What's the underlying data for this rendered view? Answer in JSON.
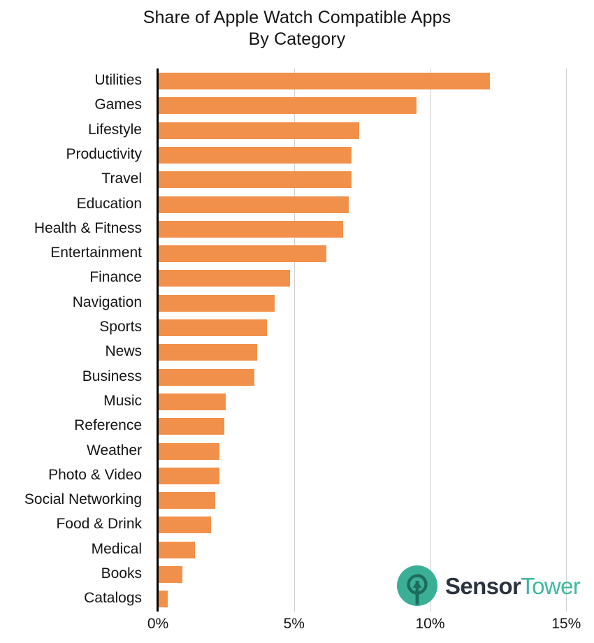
{
  "chart_data": {
    "type": "bar",
    "orientation": "horizontal",
    "title": "Share of Apple Watch Compatible Apps By Category",
    "title_lines": [
      "Share of Apple Watch Compatible Apps",
      "By Category"
    ],
    "xlabel": "",
    "ylabel": "",
    "xlim": [
      0,
      15.4
    ],
    "xticks": [
      0,
      5,
      10,
      15
    ],
    "xtick_labels": [
      "0%",
      "5%",
      "10%",
      "15%"
    ],
    "grid": "vertical",
    "legend": "none",
    "bar_color": "#F1904A",
    "categories": [
      "Utilities",
      "Games",
      "Lifestyle",
      "Productivity",
      "Travel",
      "Education",
      "Health & Fitness",
      "Entertainment",
      "Finance",
      "Navigation",
      "Sports",
      "News",
      "Business",
      "Music",
      "Reference",
      "Weather",
      "Photo & Video",
      "Social Networking",
      "Food & Drink",
      "Medical",
      "Books",
      "Catalogs"
    ],
    "values": [
      12.2,
      9.5,
      7.4,
      7.1,
      7.1,
      7.0,
      6.8,
      6.2,
      4.85,
      4.3,
      4.0,
      3.65,
      3.55,
      2.5,
      2.45,
      2.25,
      2.25,
      2.1,
      1.95,
      1.35,
      0.9,
      0.35
    ],
    "value_unit": "%"
  },
  "branding": {
    "logo_name": "sensor-tower-logo",
    "text_primary": "Sensor",
    "text_secondary": "Tower",
    "mark_color": "#3AAF96",
    "mark_inner_color": "#1D6B5C",
    "text_primary_color": "#2B3340",
    "text_secondary_color": "#3EB8A0"
  }
}
